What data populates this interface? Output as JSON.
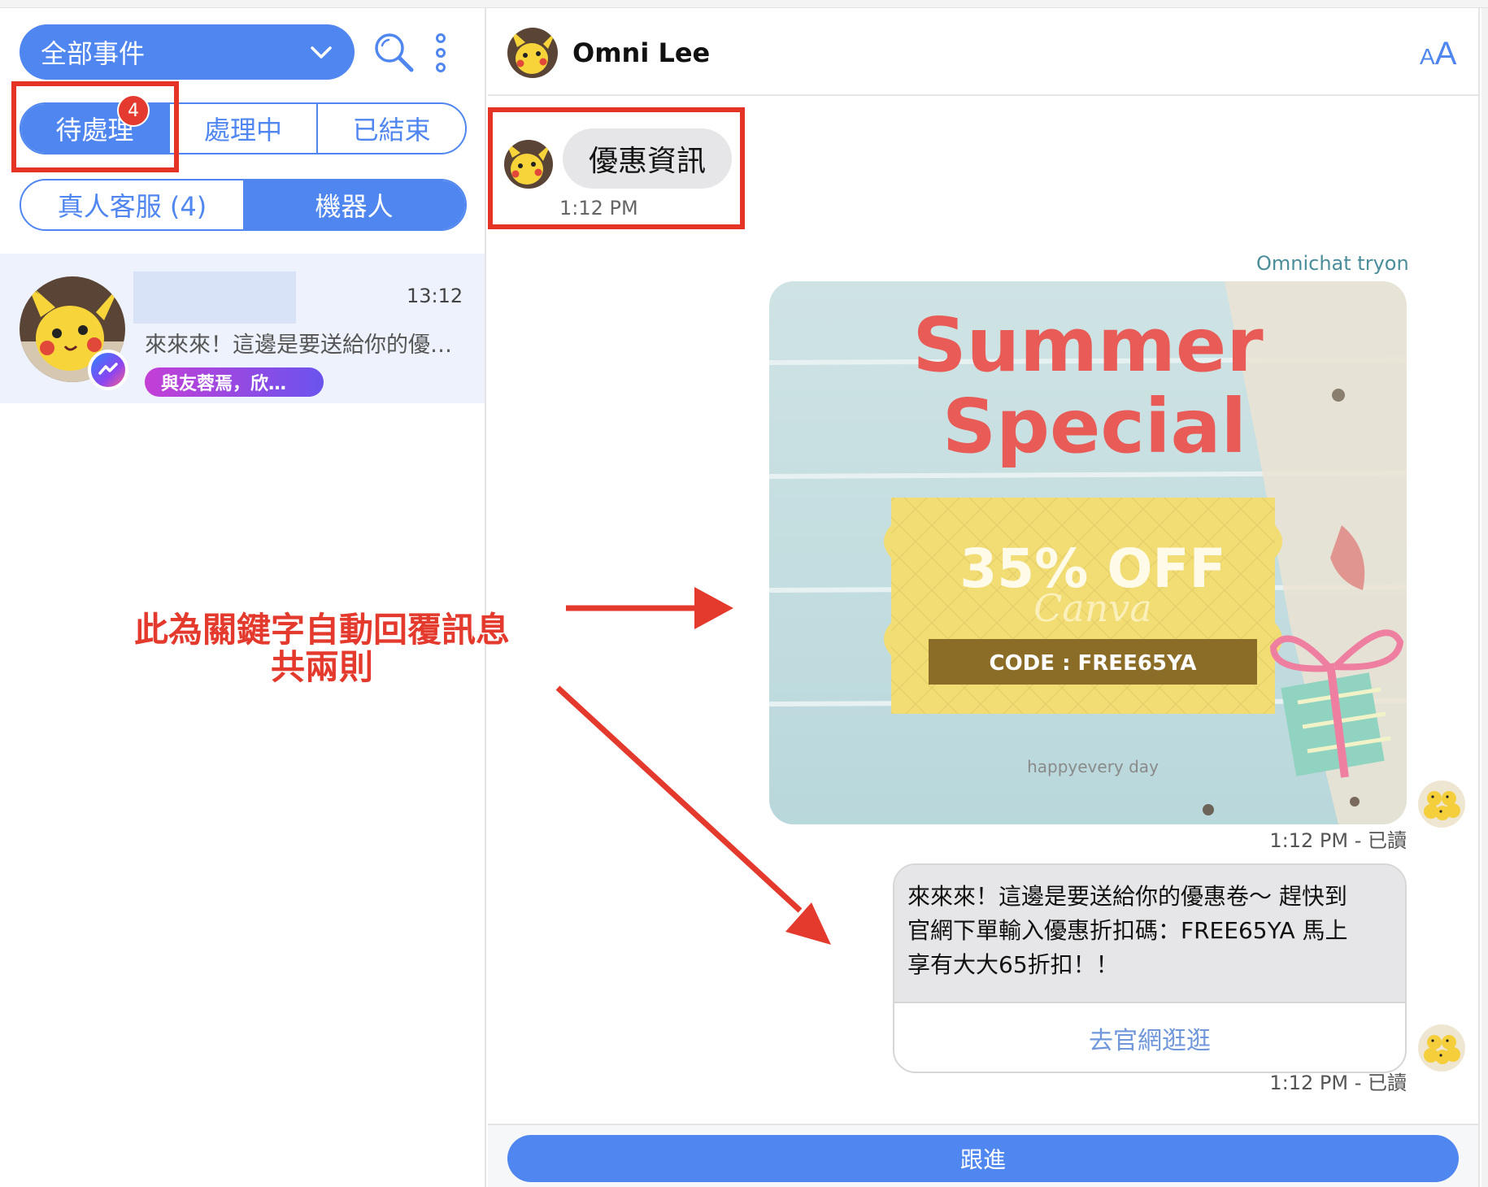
{
  "sidebar": {
    "filter_label": "全部事件",
    "status_tabs": [
      {
        "label": "待處理",
        "active": true
      },
      {
        "label": "處理中",
        "active": false
      },
      {
        "label": "已結束",
        "active": false
      }
    ],
    "pending_badge": "4",
    "agent_tabs": [
      {
        "label": "真人客服 (4)",
        "active": false
      },
      {
        "label": "機器人",
        "active": true
      }
    ],
    "conversation": {
      "time": "13:12",
      "preview": "來來來！這邊是要送給你的優…",
      "tag": "與友蓉焉，欣…"
    }
  },
  "annotation": {
    "line1": "此為關鍵字自動回覆訊息",
    "line2": "共兩則"
  },
  "chat": {
    "contact_name": "Omni Lee",
    "font_size_small": "A",
    "font_size_large": "A",
    "incoming": {
      "text": "優惠資訊",
      "time": "1:12 PM"
    },
    "sender_name": "Omnichat tryon",
    "promo_image": {
      "title_line1": "Summer",
      "title_line2": "Special",
      "discount": "35% OFF",
      "script": "Canva",
      "code": "CODE : FREE65YA",
      "footer": "happyevery day"
    },
    "image_time": "1:12 PM - 已讀",
    "text_message": {
      "line1": "來來來！這邊是要送給你的優惠卷～ 趕快到",
      "line2": "官網下單輸入優惠折扣碼：FREE65YA 馬上",
      "line3": "享有大大65折扣！！",
      "button": "去官網逛逛"
    },
    "text_time": "1:12 PM - 已讀",
    "follow_button": "跟進"
  },
  "colors": {
    "primary": "#4f86f0",
    "highlight": "#e53325",
    "badge": "#e53a2f"
  }
}
